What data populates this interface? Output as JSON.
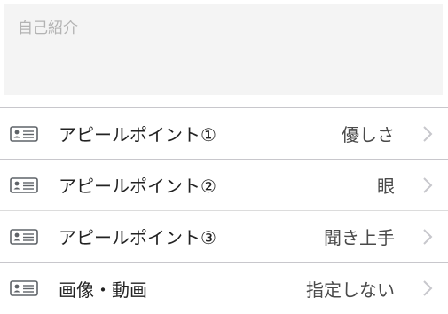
{
  "self_intro": {
    "placeholder": "自己紹介"
  },
  "rows": [
    {
      "label": "アピールポイント①",
      "value": "優しさ",
      "icon": "profile-card-icon"
    },
    {
      "label": "アピールポイント②",
      "value": "眼",
      "icon": "profile-card-icon"
    },
    {
      "label": "アピールポイント③",
      "value": "聞き上手",
      "icon": "profile-card-icon"
    },
    {
      "label": "画像・動画",
      "value": "指定しない",
      "icon": "profile-card-icon"
    }
  ],
  "colors": {
    "icon_gray": "#5f6368",
    "chevron_gray": "#c7c7cc",
    "divider": "#c8c7cc"
  }
}
